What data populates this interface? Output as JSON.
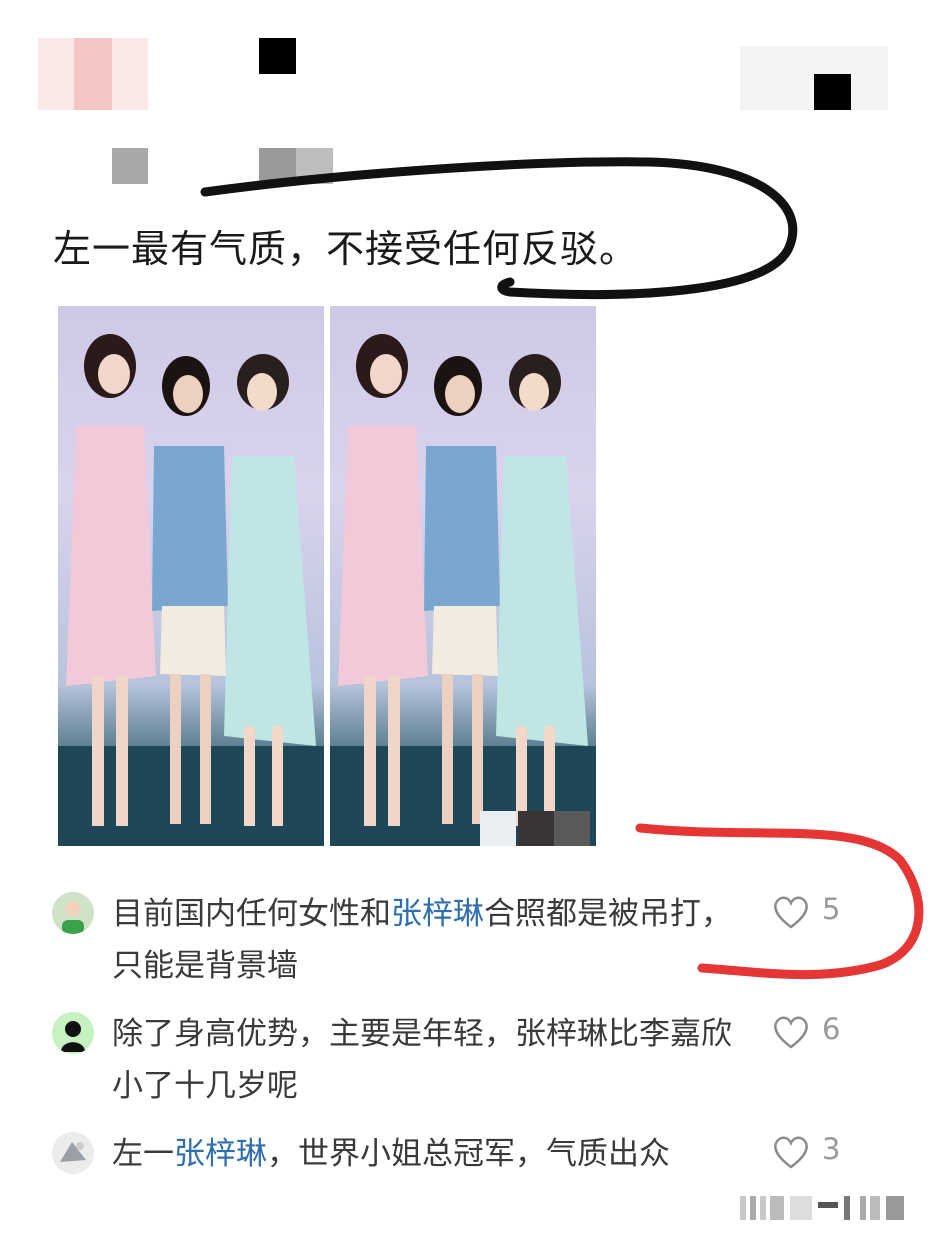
{
  "post": {
    "text": "左一最有气质，不接受任何反驳。"
  },
  "comments": [
    {
      "parts": [
        {
          "text": "目前国内任何女性和",
          "mention": false
        },
        {
          "text": "张梓琳",
          "mention": true
        },
        {
          "text": "合照都是被吊打，只能是背景墙",
          "mention": false
        }
      ],
      "likes": "5"
    },
    {
      "parts": [
        {
          "text": "除了身高优势，主要是年轻，张梓琳比李嘉欣小了十几岁呢",
          "mention": false
        }
      ],
      "likes": "6"
    },
    {
      "parts": [
        {
          "text": "左一",
          "mention": false
        },
        {
          "text": "张梓琳",
          "mention": true
        },
        {
          "text": "，世界小姐总冠军，气质出众",
          "mention": false
        }
      ],
      "likes": "3"
    }
  ],
  "colors": {
    "mention": "#2f6fb0",
    "annotation_black": "#111111",
    "annotation_red": "#e53535"
  }
}
